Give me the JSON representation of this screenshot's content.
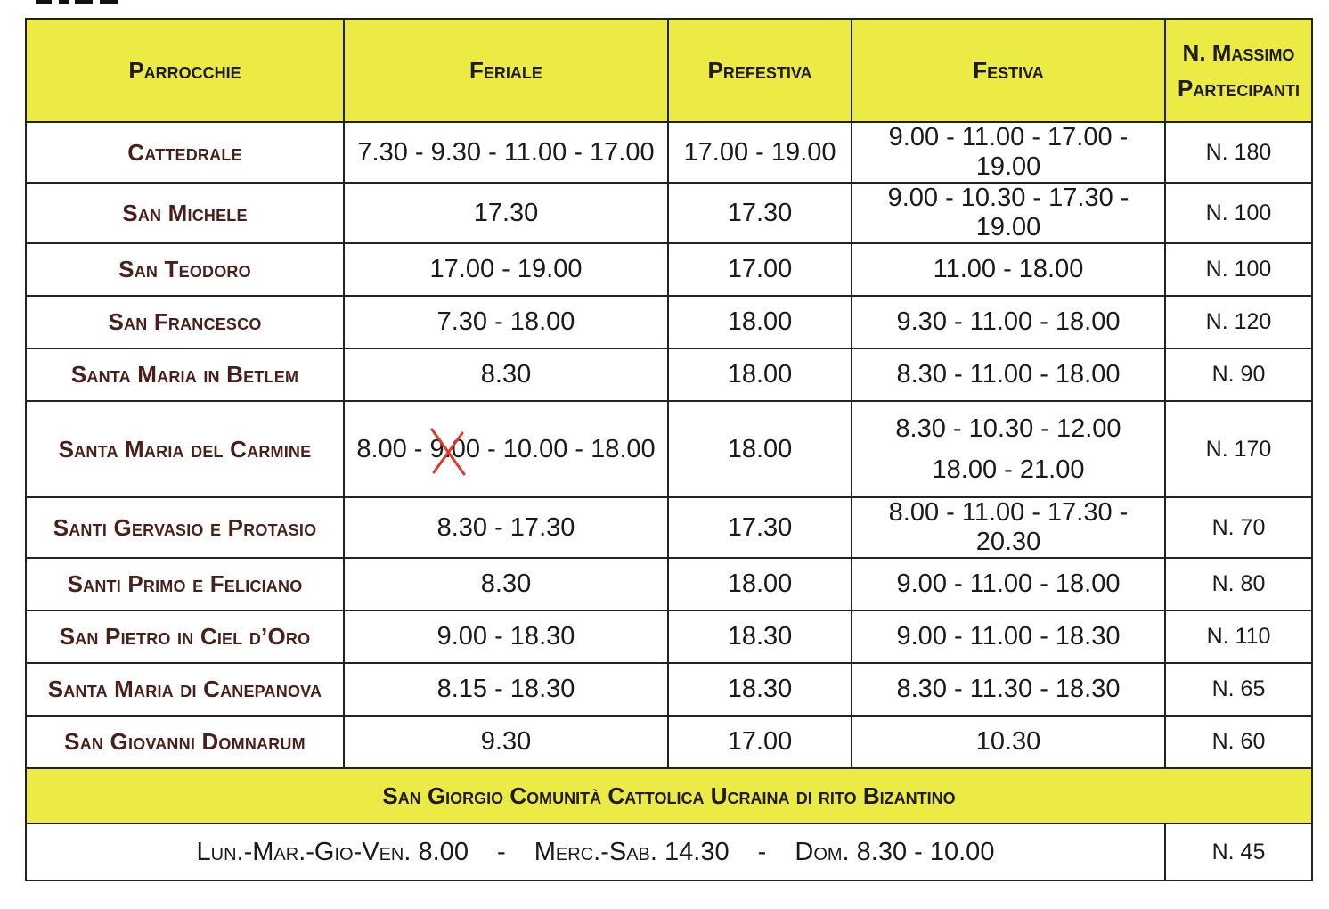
{
  "header": {
    "parrocchie": "Parrocchie",
    "feriale": "Feriale",
    "prefestiva": "Prefestiva",
    "festiva": "Festiva",
    "max_line1": "N. Massimo",
    "max_line2": "Partecipanti"
  },
  "rows": [
    {
      "parrocchia": "Cattedrale",
      "feriale": "7.30 - 9.30 - 11.00 - 17.00",
      "prefestiva": "17.00 - 19.00",
      "festiva": "9.00 - 11.00 - 17.00 - 19.00",
      "max": "N. 180"
    },
    {
      "parrocchia": "San Michele",
      "feriale": "17.30",
      "prefestiva": "17.30",
      "festiva": "9.00 - 10.30 - 17.30 - 19.00",
      "max": "N. 100"
    },
    {
      "parrocchia": "San Teodoro",
      "feriale": "17.00 - 19.00",
      "prefestiva": "17.00",
      "festiva": "11.00 - 18.00",
      "max": "N. 100"
    },
    {
      "parrocchia": "San Francesco",
      "feriale": "7.30 - 18.00",
      "prefestiva": "18.00",
      "festiva": "9.30 - 11.00 - 18.00",
      "max": "N. 120"
    },
    {
      "parrocchia": "Santa Maria in Betlem",
      "feriale": "8.30",
      "prefestiva": "18.00",
      "festiva": "8.30 - 11.00 - 18.00",
      "max": "N. 90"
    },
    {
      "parrocchia": "Santa Maria del Carmine",
      "feriale_before": "8.00 - ",
      "feriale_struck": "9.00",
      "feriale_after": " - 10.00 - 18.00",
      "prefestiva": "18.00",
      "festiva_line1": "8.30 - 10.30 - 12.00",
      "festiva_line2": "18.00 - 21.00",
      "max": "N. 170"
    },
    {
      "parrocchia": "Santi Gervasio e Protasio",
      "feriale": "8.30 - 17.30",
      "prefestiva": "17.30",
      "festiva": "8.00 - 11.00 - 17.30 - 20.30",
      "max": "N. 70"
    },
    {
      "parrocchia": "Santi Primo e Feliciano",
      "feriale": "8.30",
      "prefestiva": "18.00",
      "festiva": "9.00 - 11.00 - 18.00",
      "max": "N. 80"
    },
    {
      "parrocchia": "San Pietro in Ciel d’Oro",
      "feriale": "9.00 - 18.30",
      "prefestiva": "18.30",
      "festiva": "9.00 - 11.00 - 18.30",
      "max": "N. 110"
    },
    {
      "parrocchia": "Santa Maria di Canepanova",
      "feriale": "8.15 - 18.30",
      "prefestiva": "18.30",
      "festiva": "8.30 - 11.30 - 18.30",
      "max": "N. 65"
    },
    {
      "parrocchia": "San Giovanni Domnarum",
      "feriale": "9.30",
      "prefestiva": "17.00",
      "festiva": "10.30",
      "max": "N. 60"
    }
  ],
  "banner": {
    "title": "San Giorgio Comunità Cattolica Ucraina di rito Bizantino"
  },
  "footer": {
    "weekdays_label": "Lun.-Mar.-Gio-Ven.",
    "weekdays_time": "8.00",
    "sep": "-",
    "midweek_label": "Merc.-Sab.",
    "midweek_time": "14.30",
    "sunday_label": "Dom.",
    "sunday_time": "8.30 - 10.00",
    "max": "N. 45"
  },
  "colors": {
    "header_yellow": "#ecea45",
    "parish_text": "#4a1f1a",
    "strike_red": "#e0392b"
  }
}
